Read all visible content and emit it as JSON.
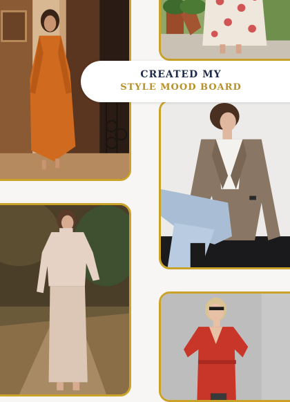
{
  "banner": {
    "line1": "CREATED MY",
    "line2": "STYLE MOOD BOARD"
  },
  "colors": {
    "frame_gold": "#c9a227",
    "title_navy": "#1e2a4a",
    "subtitle_gold": "#b8902a",
    "background": "#f7f6f4"
  },
  "photos": [
    {
      "name": "orange-kaftan-dress-photo"
    },
    {
      "name": "floral-skirt-photo"
    },
    {
      "name": "taupe-blazer-jeans-photo"
    },
    {
      "name": "cream-knit-set-photo"
    },
    {
      "name": "red-wrap-dress-photo"
    }
  ]
}
